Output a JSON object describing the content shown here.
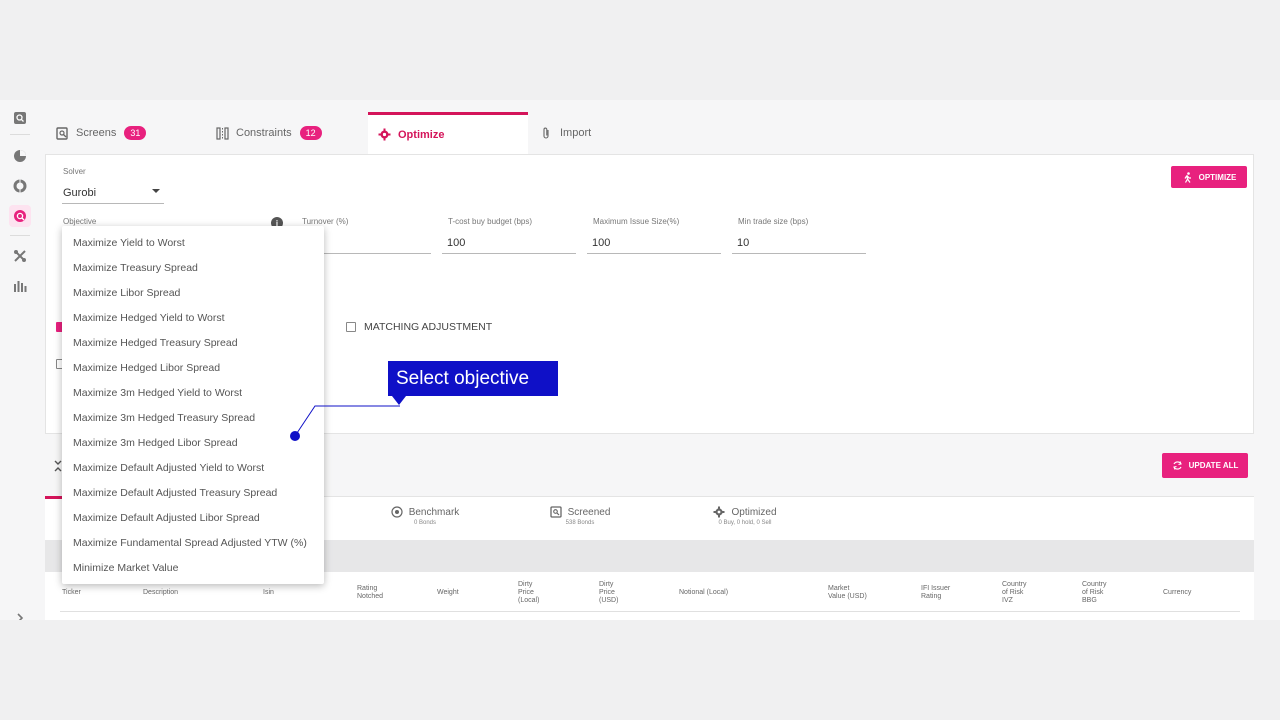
{
  "tabs": [
    {
      "label": "Screens",
      "badge": "31",
      "icon": "screen-search-icon"
    },
    {
      "label": "Constraints",
      "badge": "12",
      "icon": "constraints-icon"
    },
    {
      "label": "Optimize",
      "icon": "gear-icon"
    },
    {
      "label": "Import",
      "icon": "paperclip-icon"
    }
  ],
  "form": {
    "solver_label": "Solver",
    "solver_value": "Gurobi",
    "objective_label": "Objective",
    "turnover_label": "Turnover (%)",
    "tcost_label": "T-cost buy budget (bps)",
    "tcost_value": "100",
    "max_issue_label": "Maximum Issue Size(%)",
    "max_issue_value": "100",
    "min_trade_label": "Min trade size (bps)",
    "min_trade_value": "10",
    "matching_label": "MATCHING ADJUSTMENT",
    "info_glyph": "i"
  },
  "buttons": {
    "optimize": "OPTIMIZE",
    "update_all": "UPDATE ALL"
  },
  "dropdown": {
    "items": [
      "Maximize Yield to Worst",
      "Maximize Treasury Spread",
      "Maximize Libor Spread",
      "Maximize Hedged Yield to Worst",
      "Maximize Hedged Treasury Spread",
      "Maximize Hedged Libor Spread",
      "Maximize 3m Hedged Yield to Worst",
      "Maximize 3m Hedged Treasury Spread",
      "Maximize 3m Hedged Libor Spread",
      "Maximize Default Adjusted Yield to Worst",
      "Maximize Default Adjusted Treasury Spread",
      "Maximize Default Adjusted Libor Spread",
      "Maximize Fundamental Spread Adjusted YTW (%)",
      "Minimize Market Value"
    ]
  },
  "subtabs": [
    {
      "title": "Benchmark",
      "sub": "0 Bonds"
    },
    {
      "title": "Screened",
      "sub": "538 Bonds"
    },
    {
      "title": "Optimized",
      "sub": "0 Buy, 0 hold, 0 Sell"
    }
  ],
  "table": {
    "headers": [
      "Ticker",
      "Description",
      "Isin",
      "Rating\nNotched",
      "Weight",
      "Dirty\nPrice\n(Local)",
      "Dirty\nPrice\n(USD)",
      "Notional (Local)",
      "Market\nValue (USD)",
      "IFI Issuer\nRating",
      "Country\nof Risk\nIVZ",
      "Country\nof Risk\nBBG",
      "Currency"
    ]
  },
  "callout": {
    "text": "Select objective"
  },
  "colors": {
    "accent": "#e8217e",
    "callout": "#0f10c7"
  }
}
